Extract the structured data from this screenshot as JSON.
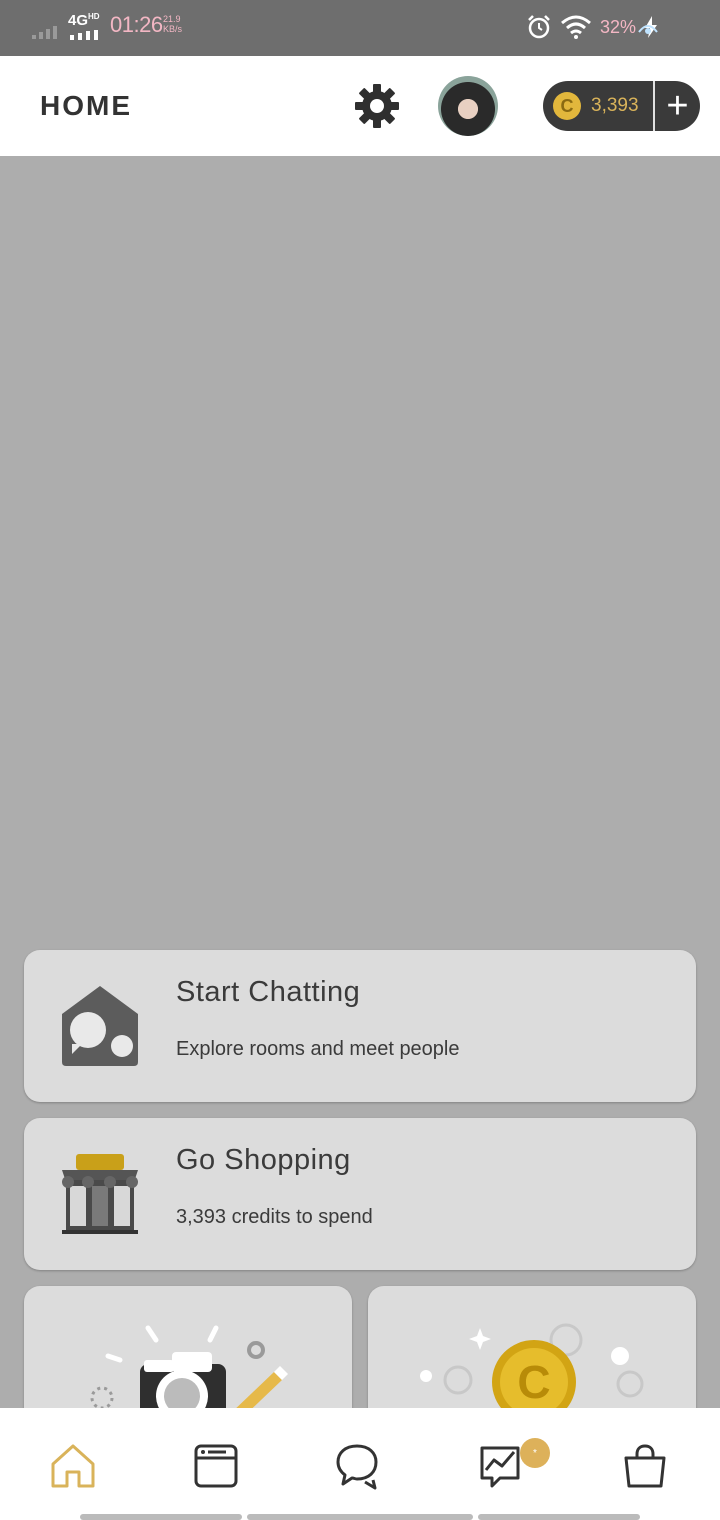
{
  "status_bar": {
    "network": "4G",
    "network_sup": "HD",
    "time": "01:26",
    "speed_value": "21.9",
    "speed_unit": "KB/s",
    "battery": "32%"
  },
  "header": {
    "title": "HOME",
    "credits": "3,393",
    "add_label": "+",
    "coin_symbol": "C"
  },
  "cards": [
    {
      "title": "Start Chatting",
      "subtitle": "Explore rooms and meet people"
    },
    {
      "title": "Go Shopping",
      "subtitle": "3,393 credits to spend"
    }
  ],
  "bottom_nav": {
    "items": [
      {
        "icon": "home-icon",
        "active": true
      },
      {
        "icon": "window-icon",
        "active": false
      },
      {
        "icon": "chat-icon",
        "active": false
      },
      {
        "icon": "activity-icon",
        "active": false
      },
      {
        "icon": "shopping-bag-icon",
        "active": false
      }
    ],
    "badge": "*"
  },
  "colors": {
    "accent": "#d9b35a",
    "background": "#adadad",
    "card": "#dcdcdc",
    "statusbar": "#6e6e6e"
  }
}
